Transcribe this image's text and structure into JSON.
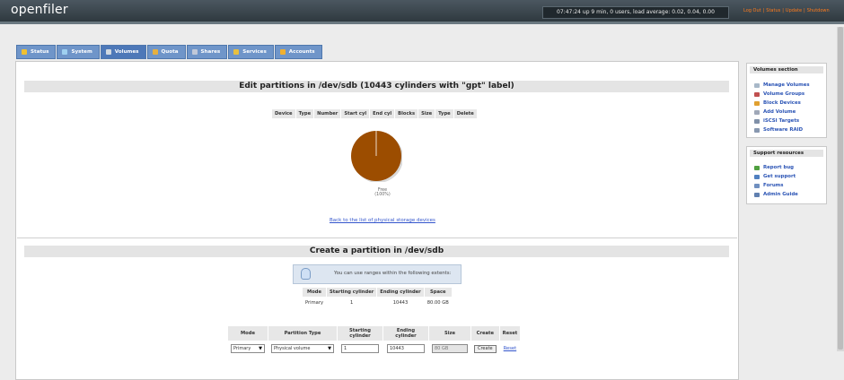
{
  "header": {
    "logo": "openfiler",
    "status": "07:47:24 up 9 min, 0 users, load average: 0.02, 0.04, 0.00",
    "links": [
      "Log Out",
      "Status",
      "Update",
      "Shutdown"
    ]
  },
  "tabs": [
    {
      "label": "Status",
      "icon": "status-icon",
      "active": false
    },
    {
      "label": "System",
      "icon": "system-icon",
      "active": false
    },
    {
      "label": "Volumes",
      "icon": "volumes-icon",
      "active": true
    },
    {
      "label": "Quota",
      "icon": "quota-icon",
      "active": false
    },
    {
      "label": "Shares",
      "icon": "shares-icon",
      "active": false
    },
    {
      "label": "Services",
      "icon": "services-icon",
      "active": false
    },
    {
      "label": "Accounts",
      "icon": "accounts-icon",
      "active": false
    }
  ],
  "edit": {
    "title": "Edit partitions in /dev/sdb (10443 cylinders with \"gpt\" label)",
    "columns": [
      "Device",
      "Type",
      "Number",
      "Start cyl",
      "End cyl",
      "Blocks",
      "Size",
      "Type",
      "Delete"
    ],
    "pie_label_1": "Free",
    "pie_label_2": "(100%)",
    "pie_color": "#9c4d00",
    "back_link": "Back to the list of physical storage devices"
  },
  "create": {
    "title": "Create a partition in /dev/sdb",
    "tip": "You can use ranges within the following extents:",
    "extents_columns": [
      "Mode",
      "Starting cylinder",
      "Ending cylinder",
      "Space"
    ],
    "extents_row": [
      "Primary",
      "1",
      "10443",
      "80.00 GB"
    ],
    "form_columns": [
      "Mode",
      "Partition Type",
      "Starting cylinder",
      "Ending cylinder",
      "Size",
      "Create",
      "Reset"
    ],
    "form": {
      "mode": "Primary",
      "partition_type": "Physical volume",
      "start": "1",
      "end": "10443",
      "size": "80 GB",
      "create_label": "Create",
      "reset_label": "Reset"
    }
  },
  "sidebar": {
    "volumes_title": "Volumes section",
    "volumes_items": [
      {
        "label": "Manage Volumes",
        "icon": "manage-volumes-icon"
      },
      {
        "label": "Volume Groups",
        "icon": "volume-groups-icon"
      },
      {
        "label": "Block Devices",
        "icon": "block-devices-icon"
      },
      {
        "label": "Add Volume",
        "icon": "add-volume-icon"
      },
      {
        "label": "iSCSI Targets",
        "icon": "iscsi-targets-icon"
      },
      {
        "label": "Software RAID",
        "icon": "software-raid-icon"
      }
    ],
    "support_title": "Support resources",
    "support_items": [
      {
        "label": "Report bug",
        "icon": "report-bug-icon"
      },
      {
        "label": "Get support",
        "icon": "get-support-icon"
      },
      {
        "label": "Forums",
        "icon": "forums-icon"
      },
      {
        "label": "Admin Guide",
        "icon": "admin-guide-icon"
      }
    ]
  }
}
